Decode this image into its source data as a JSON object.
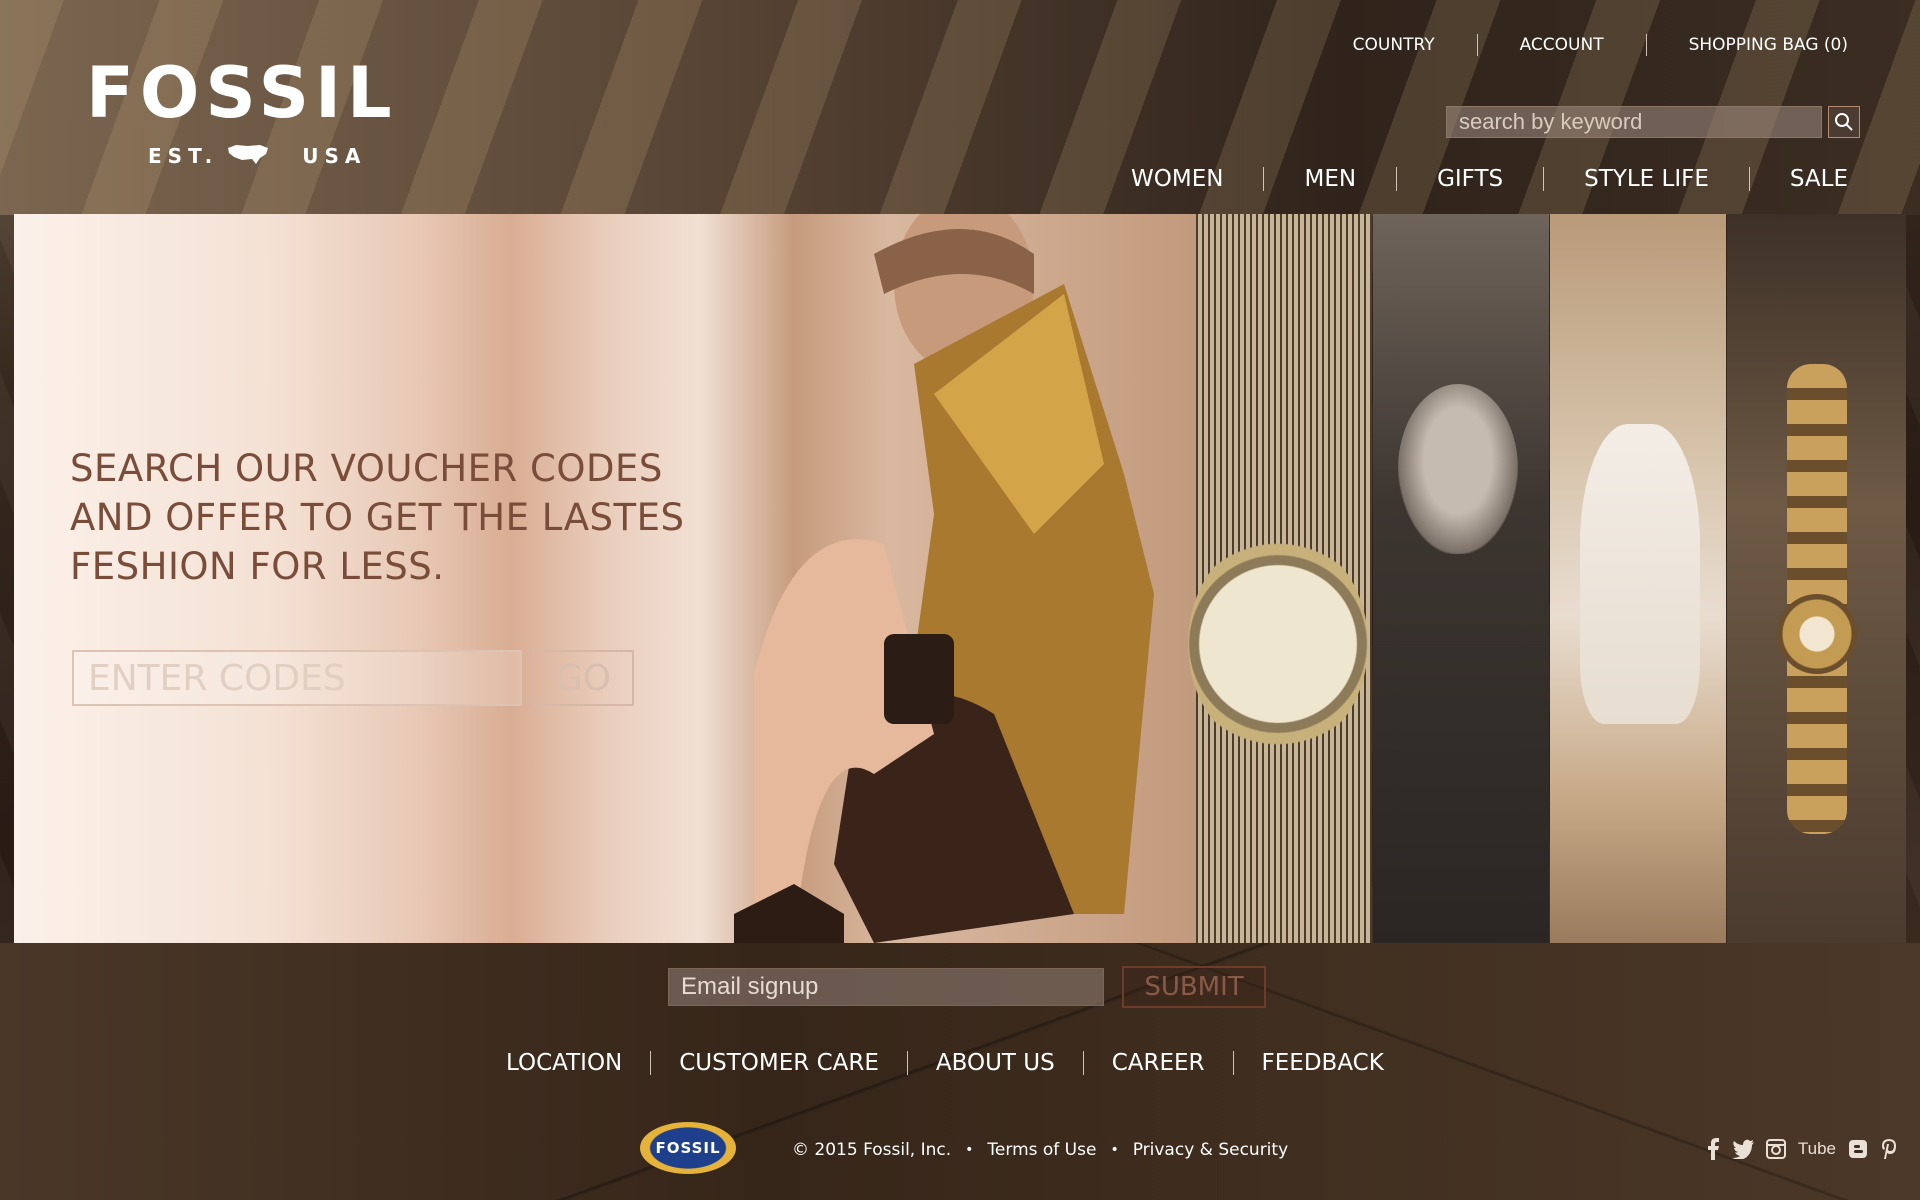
{
  "brand": {
    "logo_word": "FOSSIL",
    "logo_tagline_left": "EST.",
    "logo_tagline_right": "USA"
  },
  "utility_nav": [
    {
      "label": "COUNTRY"
    },
    {
      "label": "ACCOUNT"
    },
    {
      "label": "SHOPPING BAG (0)"
    }
  ],
  "search": {
    "placeholder": "search by keyword",
    "icon": "magnifier-icon"
  },
  "main_nav": [
    {
      "label": "WOMEN"
    },
    {
      "label": "MEN"
    },
    {
      "label": "GIFTS"
    },
    {
      "label": "STYLE LIFE"
    },
    {
      "label": "SALE"
    }
  ],
  "hero": {
    "headline_lines": [
      "SEARCH OUR VOUCHER CODES",
      "AND OFFER TO GET THE LASTES",
      "FESHION FOR LESS."
    ],
    "code_placeholder": "ENTER CODES",
    "go_label": "GO",
    "text_color": "#7a4c3a"
  },
  "newsletter": {
    "placeholder": "Email signup",
    "submit_label": "SUBMIT"
  },
  "footer_nav": [
    {
      "label": "LOCATION"
    },
    {
      "label": "CUSTOMER CARE"
    },
    {
      "label": "ABOUT US"
    },
    {
      "label": "CAREER"
    },
    {
      "label": "FEEDBACK"
    }
  ],
  "footer": {
    "badge_text": "FOSSIL",
    "copyright": "© 2015 Fossil, Inc.",
    "terms": "Terms of Use",
    "privacy": "Privacy & Security",
    "social_tube": "Tube"
  },
  "social_icons": [
    "facebook-icon",
    "twitter-icon",
    "instagram-icon",
    "youtube-icon",
    "blogger-icon",
    "pinterest-icon"
  ]
}
